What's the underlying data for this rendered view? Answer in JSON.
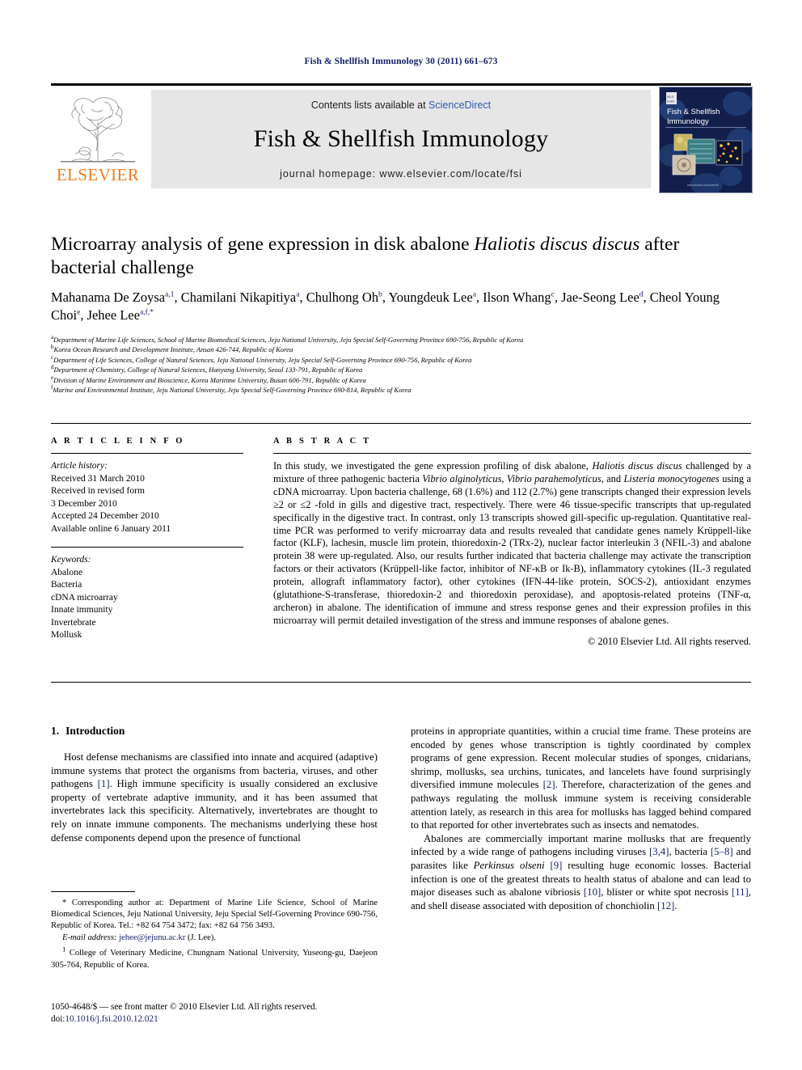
{
  "running_head": "Fish & Shellfish Immunology 30 (2011) 661–673",
  "masthead": {
    "publisher_wordmark": "ELSEVIER",
    "contents_prefix": "Contents lists available at ",
    "sciencedirect": "ScienceDirect",
    "journal_title": "Fish & Shellfish Immunology",
    "homepage": "journal homepage: www.elsevier.com/locate/fsi",
    "cover": {
      "line1": "Fish & Shellfish",
      "line2": "Immunology",
      "footer_text": "www.elsevier.com/locate/fsi"
    },
    "colors": {
      "band_background": "#e6e6e6",
      "sciencedirect_link": "#2a5ca8",
      "elsevier_orange": "#ef7d1a",
      "cover_navy": "#111f4a"
    }
  },
  "article": {
    "title_part1": "Microarray analysis of gene expression in disk abalone ",
    "title_italic": "Haliotis discus discus",
    "title_part2": " after bacterial challenge",
    "authors": [
      {
        "name": "Mahanama De Zoysa",
        "sup": "a,1",
        "sep": ", "
      },
      {
        "name": "Chamilani Nikapitiya",
        "sup": "a",
        "sep": ", "
      },
      {
        "name": "Chulhong Oh",
        "sup": "b",
        "sep": ", "
      },
      {
        "name": "Youngdeuk Lee",
        "sup": "a",
        "sep": ", "
      },
      {
        "name": "Ilson Whang",
        "sup": "c",
        "sep": ", "
      },
      {
        "name": "Jae-Seong Lee",
        "sup": "d",
        "sep": ", "
      },
      {
        "name": "Cheol Young Choi",
        "sup": "e",
        "sep": ", "
      },
      {
        "name": "Jehee Lee",
        "sup": "a,f,*",
        "sep": ""
      }
    ],
    "affiliations": [
      {
        "mark": "a",
        "text": "Department of Marine Life Sciences, School of Marine Biomedical Sciences, Jeju National University, Jeju Special Self-Governing Province 690-756, Republic of Korea"
      },
      {
        "mark": "b",
        "text": "Korea Ocean Research and Development Institute, Ansan 426-744, Republic of Korea"
      },
      {
        "mark": "c",
        "text": "Department of Life Sciences, College of Natural Sciences, Jeju National University, Jeju Special Self-Governing Province 690-756, Republic of Korea"
      },
      {
        "mark": "d",
        "text": "Department of Chemistry, College of Natural Sciences, Hanyang University, Seoul 133-791, Republic of Korea"
      },
      {
        "mark": "e",
        "text": "Division of Marine Environment and Bioscience, Korea Maritime University, Busan 606-791, Republic of Korea"
      },
      {
        "mark": "f",
        "text": "Marine and Environmental Institute, Jeju National University, Jeju Special Self-Governing Province 690-814, Republic of Korea"
      }
    ]
  },
  "article_info": {
    "heading": "A R T I C L E   I N F O",
    "history_label": "Article history:",
    "history": [
      "Received 31 March 2010",
      "Received in revised form",
      "3 December 2010",
      "Accepted 24 December 2010",
      "Available online 6 January 2011"
    ],
    "keywords_label": "Keywords:",
    "keywords": [
      "Abalone",
      "Bacteria",
      "cDNA microarray",
      "Innate immunity",
      "Invertebrate",
      "Mollusk"
    ]
  },
  "abstract": {
    "heading": "A B S T R A C T",
    "copyright": "© 2010 Elsevier Ltd. All rights reserved."
  },
  "introduction": {
    "number": "1.",
    "heading": "Introduction"
  },
  "footnotes": {
    "corresponding": "* Corresponding author at: Department of Marine Life Science, School of Marine Biomedical Sciences, Jeju National University, Jeju Special Self-Governing Province 690-756, Republic of Korea. Tel.: +82 64 754 3472; fax: +82 64 756 3493.",
    "email_label": "E-mail address:",
    "email": "jehee@jejunu.ac.kr",
    "email_suffix": " (J. Lee).",
    "note1_mark": "1",
    "note1": "College of Veterinary Medicine, Chungnam National University, Yuseong-gu, Daejeon 305-764, Republic of Korea."
  },
  "footer": {
    "issn_line": "1050-4648/$ — see front matter © 2010 Elsevier Ltd. All rights reserved.",
    "doi_label": "doi:",
    "doi": "10.1016/j.fsi.2010.12.021"
  }
}
